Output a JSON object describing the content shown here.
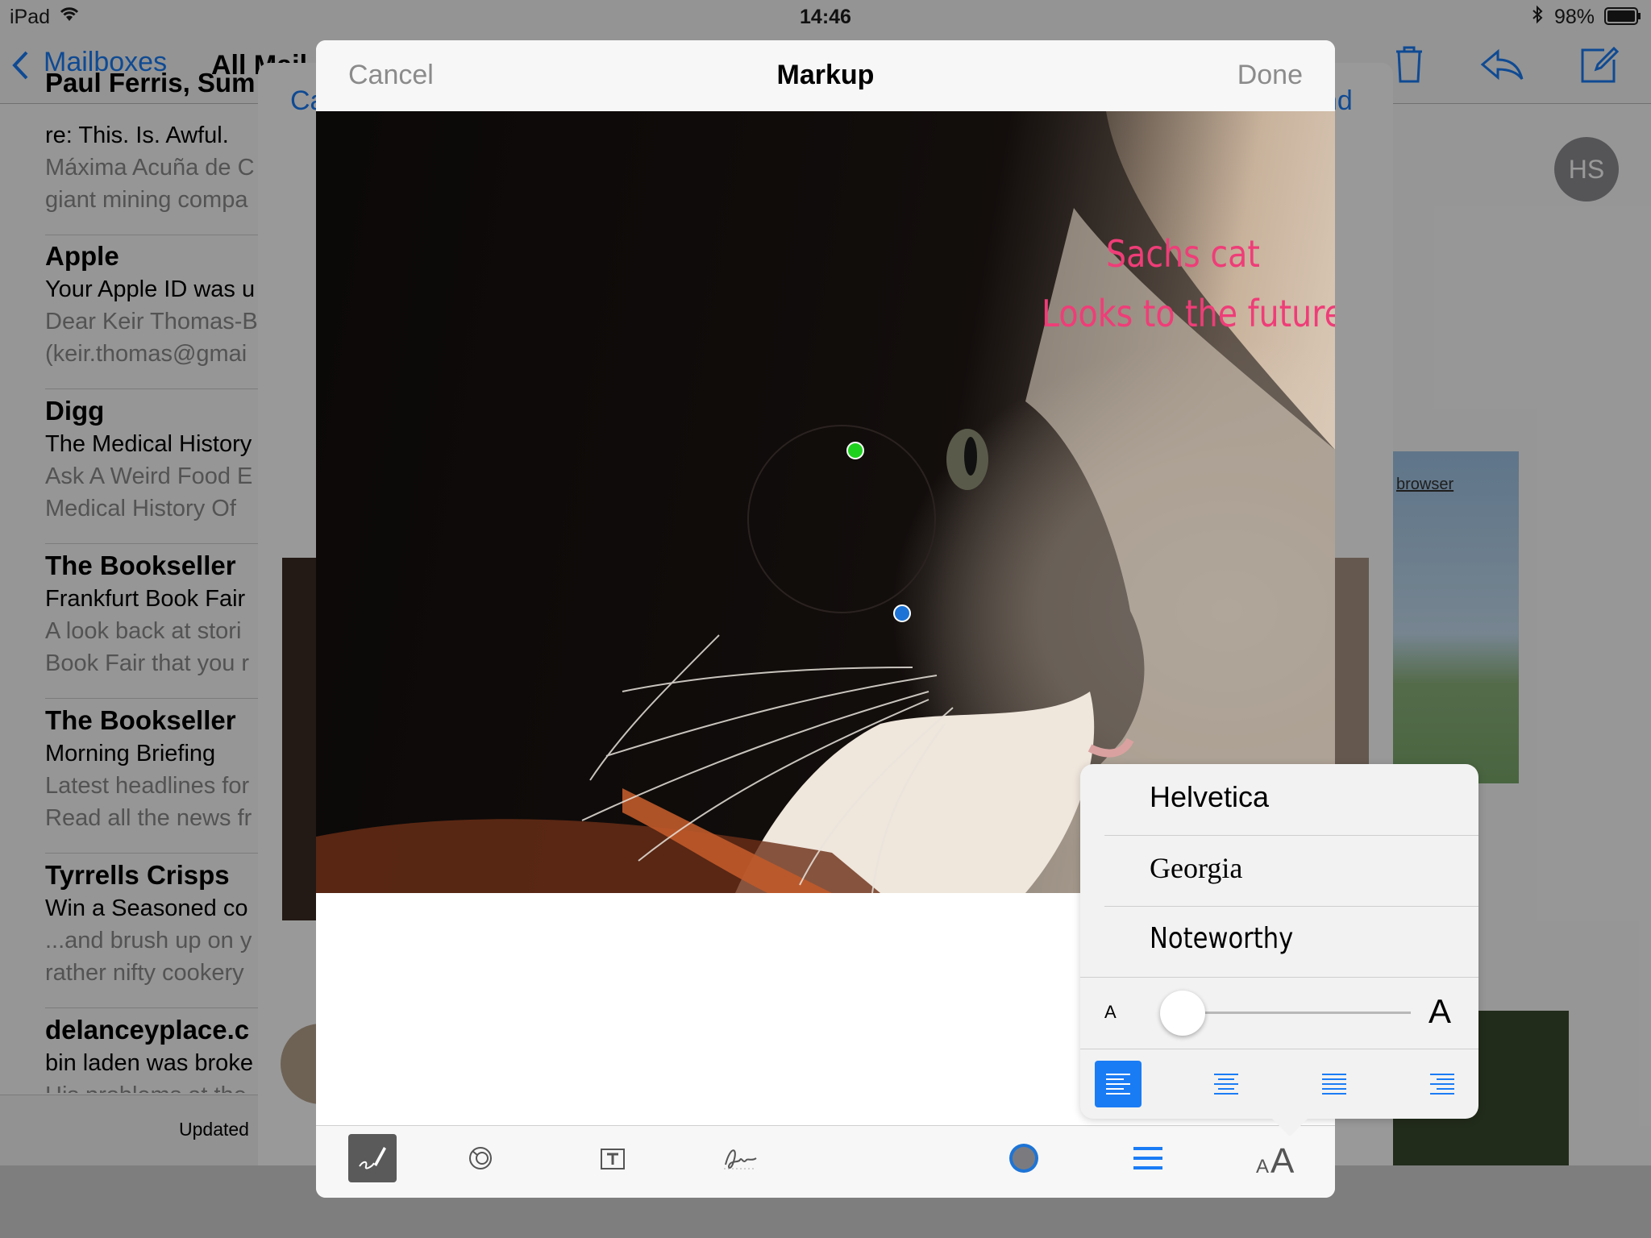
{
  "status_bar": {
    "device": "iPad",
    "time": "14:46",
    "battery": "98%",
    "wifi_icon": "wifi-icon",
    "bluetooth_icon": "bluetooth-icon"
  },
  "mail": {
    "back_label": "Mailboxes",
    "mailbox_title": "All Mail",
    "updated_text": "Updated",
    "messages": [
      {
        "sender": "Paul Ferris, Sum",
        "subject": "re: This. Is. Awful.",
        "preview1": "Máxima Acuña de C",
        "preview2": "giant mining compa"
      },
      {
        "sender": "Apple",
        "subject": "Your Apple ID was u",
        "preview1": "Dear Keir Thomas-B",
        "preview2": "(keir.thomas@gmai"
      },
      {
        "sender": "Digg",
        "subject": "The Medical History",
        "preview1": "Ask A Weird Food E",
        "preview2": "Medical History Of"
      },
      {
        "sender": "The Bookseller",
        "subject": "Frankfurt Book Fair",
        "preview1": "A look back at stori",
        "preview2": "Book Fair that you r"
      },
      {
        "sender": "The Bookseller",
        "subject": "Morning Briefing",
        "preview1": "Latest headlines for",
        "preview2": "Read all the news fr"
      },
      {
        "sender": "Tyrrells Crisps",
        "subject": "Win a Seasoned co",
        "preview1": "...and brush up on y",
        "preview2": "rather nifty cookery"
      },
      {
        "sender": "delanceyplace.c",
        "subject": "bin laden was broke",
        "preview1": "His problems at the",
        "preview2": ""
      }
    ],
    "behind_cancel": "Ca",
    "behind_send": "nd",
    "avatar_initials": "HS",
    "browser_link": "browser"
  },
  "markup": {
    "cancel_label": "Cancel",
    "title": "Markup",
    "done_label": "Done",
    "captions": [
      "Sachs cat",
      "Looks to the future"
    ],
    "toolbar": {
      "sketch_icon": "sketch-icon",
      "magnifier_icon": "magnifier-icon",
      "text_icon": "text-box-icon",
      "signature_icon": "signature-icon",
      "color_icon": "color-picker-icon",
      "lines_icon": "line-weight-icon",
      "font_icon": "font-style-icon"
    },
    "font_popover": {
      "fonts": [
        "Helvetica",
        "Georgia",
        "Noteworthy"
      ],
      "selected_font": "Noteworthy",
      "size_small_label": "A",
      "size_large_label": "A",
      "size_value": 0.05,
      "alignments": [
        "left",
        "center",
        "justify",
        "right"
      ],
      "selected_alignment": "left"
    }
  },
  "colors": {
    "accent": "#1a7cf5",
    "caption": "#ef3d78",
    "handle_green": "#1fd11f",
    "handle_blue": "#1d74d6",
    "color_swatch": "#1d74d6"
  }
}
